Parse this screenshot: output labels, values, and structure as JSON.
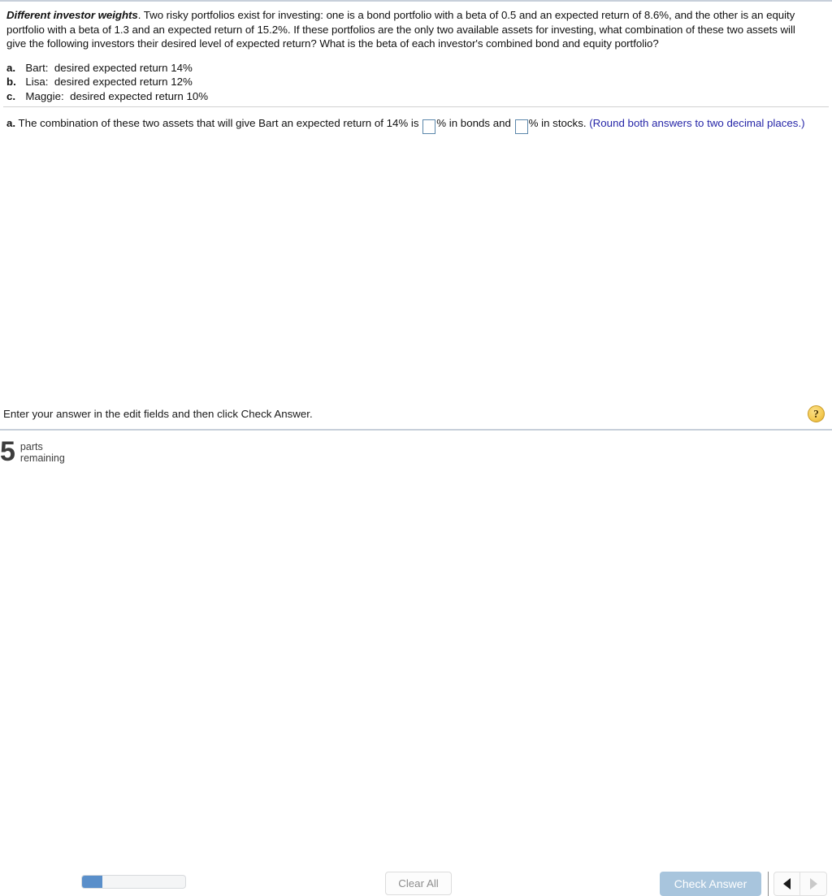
{
  "problem": {
    "title": "Different investor weights",
    "statement": ".  Two risky portfolios exist for investing:  one is a bond portfolio with a beta of 0.5 and an expected return of 8.6%, and the other is an equity portfolio with a beta of 1.3 and an expected return of 15.2%.  If these portfolios are the only two available assets for investing, what combination of these two assets will give the following investors their desired level of expected return?  What is the beta of each investor's combined bond and equity portfolio?",
    "parts": [
      {
        "letter": "a.",
        "text": "  Bart:  desired expected return 14%"
      },
      {
        "letter": "b.",
        "text": "  Lisa:  desired expected return 12%"
      },
      {
        "letter": "c.",
        "text": "  Maggie:  desired expected return 10%"
      }
    ]
  },
  "answer": {
    "letter": "a.",
    "prompt": "  The combination of these two assets that will give Bart an expected return of 14% is ",
    "input1_value": "",
    "input1_placeholder": "",
    "middle": "% in bonds and ",
    "input2_value": "",
    "input2_placeholder": "",
    "suffix": "% in stocks.  ",
    "hint": "(Round both answers to two decimal places.)"
  },
  "status": {
    "message": "Enter your answer in the edit fields and then click Check Answer.",
    "help_icon": "question-mark-icon",
    "help_label": "?"
  },
  "toolbar": {
    "parts_count": "5",
    "parts_label_line1": "parts",
    "parts_label_line2": "remaining",
    "progress_percent": "20%",
    "clear_all_label": "Clear All",
    "check_answer_label": "Check Answer",
    "prev_icon": "triangle-left-icon",
    "next_icon": "triangle-right-icon"
  },
  "colors": {
    "accent_blue": "#5a8fca",
    "check_button": "#a8c5dd",
    "hint_text": "#2626a8",
    "input_border": "#5b87ab",
    "help_gold": "#f5cc56",
    "rule": "#c7cfda"
  }
}
